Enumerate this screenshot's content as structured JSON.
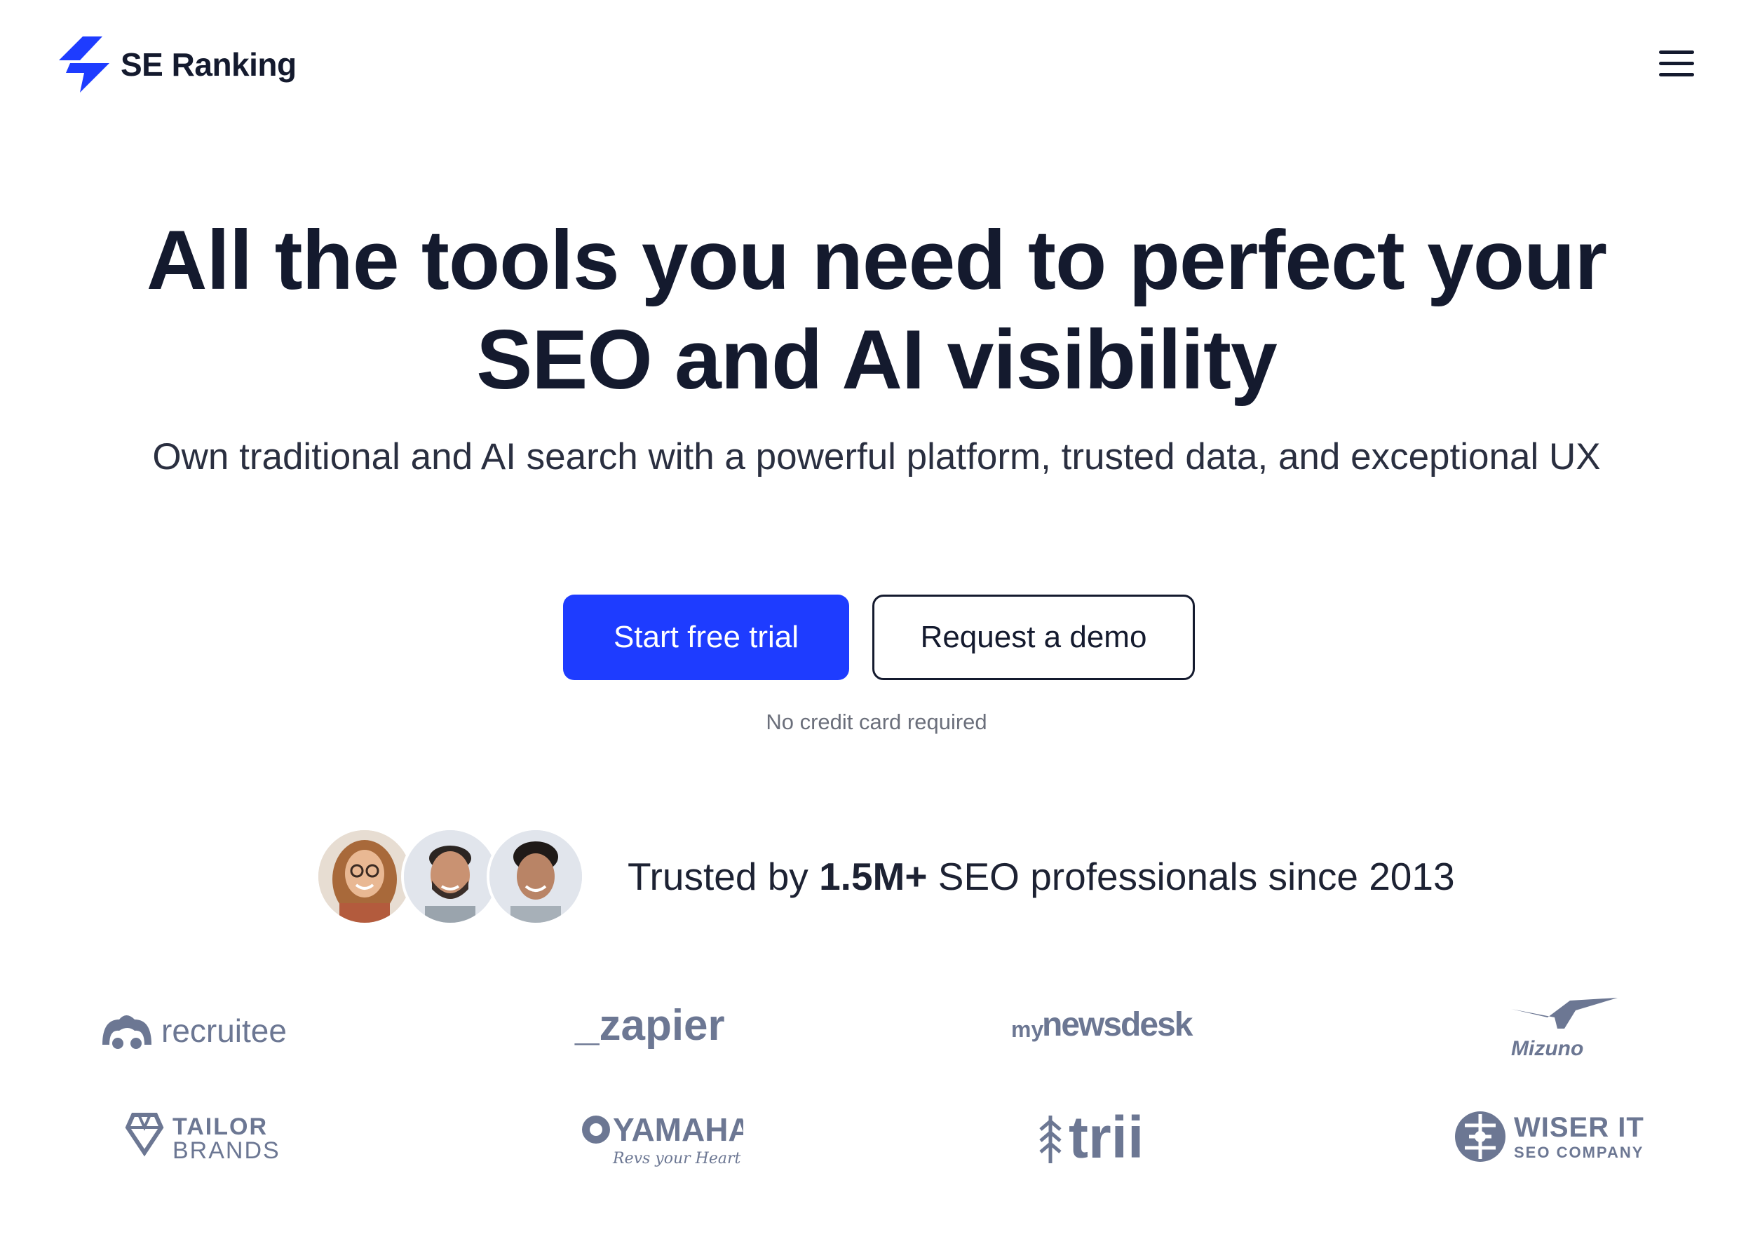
{
  "header": {
    "brand": "SE Ranking",
    "menu_icon": "hamburger-menu-icon"
  },
  "hero": {
    "title_line1": "All the tools you need to perfect your",
    "title_line2": "SEO and AI visibility",
    "subtitle": "Own traditional and AI search with a powerful platform, trusted data, and exceptional UX",
    "primary_cta": "Start free trial",
    "secondary_cta": "Request a demo",
    "note": "No credit card required"
  },
  "trust": {
    "prefix": "Trusted by ",
    "highlight": "1.5M+",
    "suffix": " SEO professionals since 2013",
    "avatars": [
      "avatar-woman-glasses",
      "avatar-man-beard",
      "avatar-man-curly"
    ]
  },
  "client_logos": [
    {
      "name": "recruitee",
      "text": "recruitee"
    },
    {
      "name": "zapier",
      "text": "_zapier"
    },
    {
      "name": "mynewsdesk",
      "text_small": "my",
      "text": "newsdesk"
    },
    {
      "name": "mizuno",
      "text": "Mizuno"
    },
    {
      "name": "tailor-brands",
      "text_top": "TAILOR",
      "text_bottom": "BRANDS"
    },
    {
      "name": "yamaha",
      "text": "YAMAHA",
      "tagline": "Revs your Heart"
    },
    {
      "name": "trii",
      "text": "trii"
    },
    {
      "name": "wiser-it",
      "text_top": "WISER IT",
      "text_bottom": "SEO COMPANY"
    }
  ],
  "colors": {
    "accent": "#1e3cff",
    "text": "#141a2e",
    "logo_gray": "#6c7793"
  }
}
